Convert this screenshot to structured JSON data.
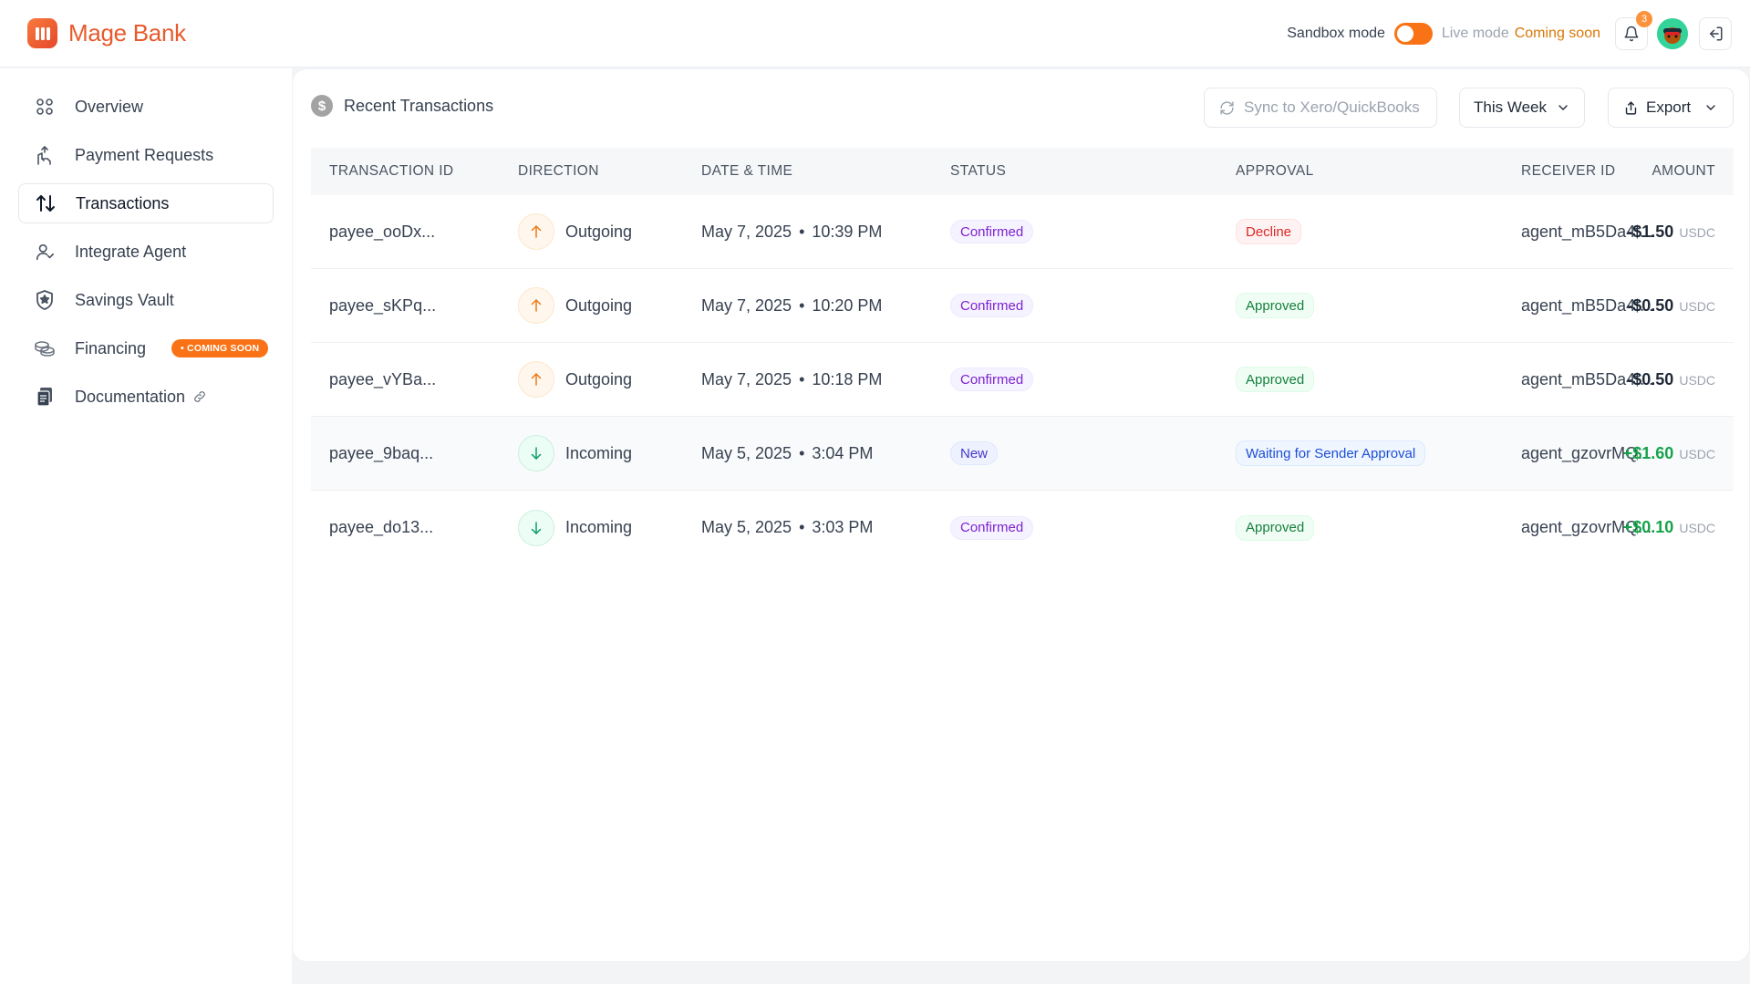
{
  "app": {
    "name": "Mage Bank",
    "logo_icon": "mage-logo"
  },
  "header": {
    "sandbox_label": "Sandbox mode",
    "sandbox_on": true,
    "live_label": "Live mode",
    "coming_soon": "Coming soon",
    "notification_count": "3",
    "accent_color": "#f97316"
  },
  "sidebar": {
    "items": [
      {
        "label": "Overview",
        "icon": "grid-icon"
      },
      {
        "label": "Payment Requests",
        "icon": "hand-coin-icon"
      },
      {
        "label": "Transactions",
        "icon": "arrows-updown-icon",
        "active": true
      },
      {
        "label": "Integrate Agent",
        "icon": "user-check-icon"
      },
      {
        "label": "Savings Vault",
        "icon": "shield-star-icon"
      },
      {
        "label": "Financing",
        "icon": "coins-icon",
        "badge": "• COMING SOON"
      },
      {
        "label": "Documentation",
        "icon": "docs-icon"
      }
    ]
  },
  "main": {
    "title": "Recent Transactions",
    "sync_label": "Sync to Xero/QuickBooks",
    "period_label": "This Week",
    "export_label": "Export",
    "columns": [
      "TRANSACTION ID",
      "DIRECTION",
      "DATE & TIME",
      "STATUS",
      "APPROVAL",
      "RECEIVER ID",
      "AMOUNT"
    ],
    "rows": [
      {
        "id": "payee_ooDx...",
        "direction": "Outgoing",
        "date": "May 7, 2025",
        "time": "10:39 PM",
        "status": "Confirmed",
        "approval": "Decline",
        "receiver": "agent_mB5Da4t...",
        "amount": "-$1.50",
        "unit": "USDC"
      },
      {
        "id": "payee_sKPq...",
        "direction": "Outgoing",
        "date": "May 7, 2025",
        "time": "10:20 PM",
        "status": "Confirmed",
        "approval": "Approved",
        "receiver": "agent_mB5Da4t...",
        "amount": "-$0.50",
        "unit": "USDC"
      },
      {
        "id": "payee_vYBa...",
        "direction": "Outgoing",
        "date": "May 7, 2025",
        "time": "10:18 PM",
        "status": "Confirmed",
        "approval": "Approved",
        "receiver": "agent_mB5Da4t...",
        "amount": "-$0.50",
        "unit": "USDC"
      },
      {
        "id": "payee_9baq...",
        "direction": "Incoming",
        "date": "May 5, 2025",
        "time": "3:04 PM",
        "status": "New",
        "approval": "Waiting for Sender Approval",
        "receiver": "agent_gzovrMQ...",
        "amount": "+$1.60",
        "unit": "USDC"
      },
      {
        "id": "payee_do13...",
        "direction": "Incoming",
        "date": "May 5, 2025",
        "time": "3:03 PM",
        "status": "Confirmed",
        "approval": "Approved",
        "receiver": "agent_gzovrMQ...",
        "amount": "+$0.10",
        "unit": "USDC"
      }
    ]
  }
}
